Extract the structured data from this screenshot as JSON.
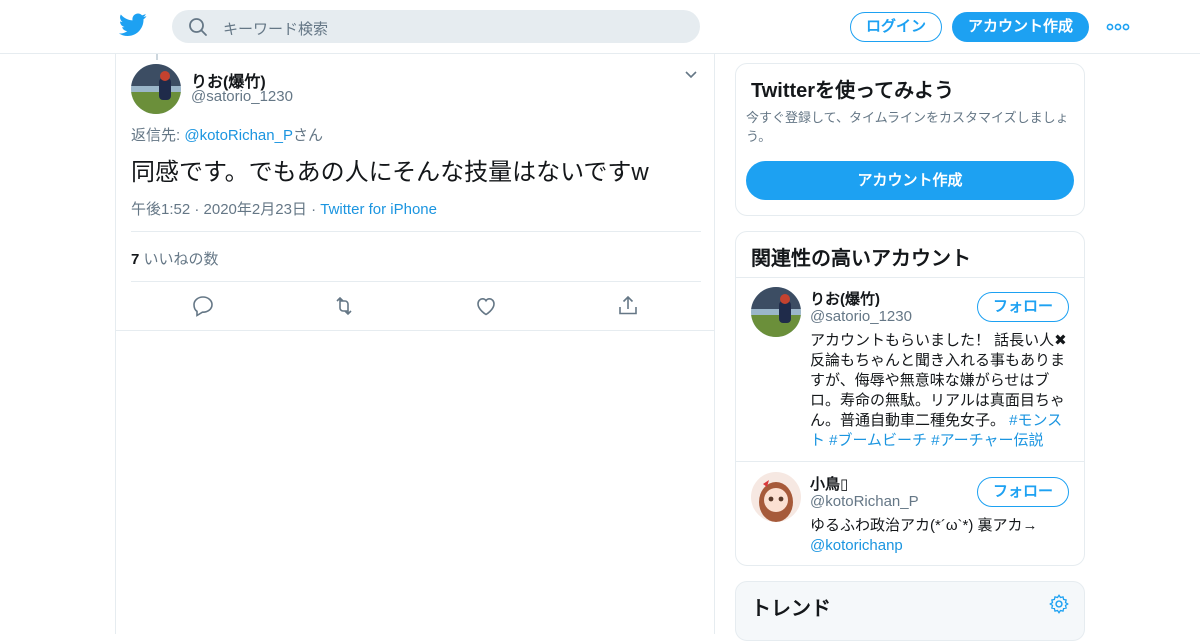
{
  "header": {
    "search_placeholder": "キーワード検索",
    "login_label": "ログイン",
    "signup_label": "アカウント作成",
    "brand_color": "#1da1f2"
  },
  "tweet": {
    "author_name": "りお(爆竹)",
    "author_handle": "@satorio_1230",
    "reply_prefix": "返信先: ",
    "reply_to": "@kotoRichan_P",
    "reply_suffix": "さん",
    "text": "同感です。でもあの人にそんな技量はないですw",
    "timestamp": "午後1:52 · 2020年2月23日",
    "meta_sep": " · ",
    "client": "Twitter for iPhone",
    "like_count": "7",
    "like_label": " いいねの数"
  },
  "sidebar": {
    "signup_card": {
      "title": "Twitterを使ってみよう",
      "desc": "今すぐ登録して、タイムラインをカスタマイズしましょう。",
      "button": "アカウント作成"
    },
    "related": {
      "title": "関連性の高いアカウント",
      "follow_label": "フォロー",
      "accounts": [
        {
          "name": "りお(爆竹)",
          "handle": "@satorio_1230",
          "bio": "アカウントもらいました！ 話長い人✖反論もちゃんと聞き入れる事もありますが、侮辱や無意味な嫌がらせはブロ。寿命の無駄。リアルは真面目ちゃん。普通自動車二種免女子。 ",
          "bio_tags": "#モンスト #ブームビーチ #アーチャー伝説"
        },
        {
          "name": "小鳥▯",
          "handle": "@kotoRichan_P",
          "bio": "ゆるふわ政治アカ(*´ω`*) 裏アカ→",
          "bio_link": "@kotorichanp"
        }
      ]
    },
    "trends": {
      "title": "トレンド"
    }
  }
}
